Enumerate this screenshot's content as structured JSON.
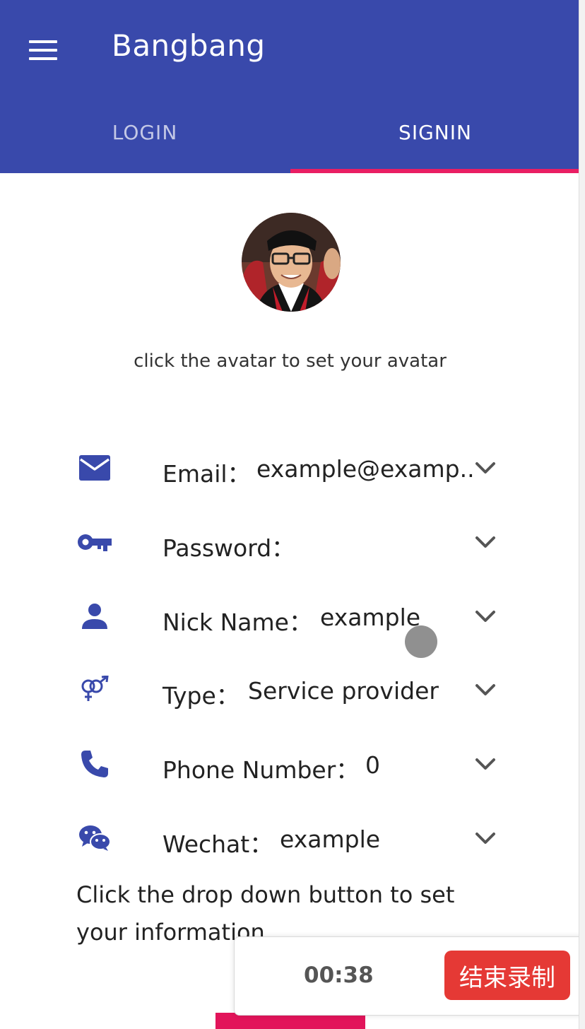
{
  "app": {
    "title": "Bangbang"
  },
  "tabs": [
    {
      "label": "LOGIN",
      "active": false
    },
    {
      "label": "SIGNIN",
      "active": true
    }
  ],
  "avatar": {
    "hint": "click the avatar to set your avatar"
  },
  "form": {
    "rows": [
      {
        "icon": "email-icon",
        "label": "Email：",
        "value": "example@examp.."
      },
      {
        "icon": "key-icon",
        "label": "Password：",
        "value": ""
      },
      {
        "icon": "person-icon",
        "label": "Nick Name：",
        "value": "example"
      },
      {
        "icon": "gender-icon",
        "label": "Type：",
        "value": "Service provider"
      },
      {
        "icon": "phone-icon",
        "label": "Phone Number：",
        "value": "0"
      },
      {
        "icon": "wechat-icon",
        "label": "Wechat：",
        "value": "example"
      }
    ],
    "hint": "Click the drop down button to set your information"
  },
  "recorder": {
    "time": "00:38",
    "stop_label": "结束录制"
  },
  "colors": {
    "primary": "#3949ab",
    "accent": "#e91e63",
    "recorder_button": "#e53935"
  }
}
